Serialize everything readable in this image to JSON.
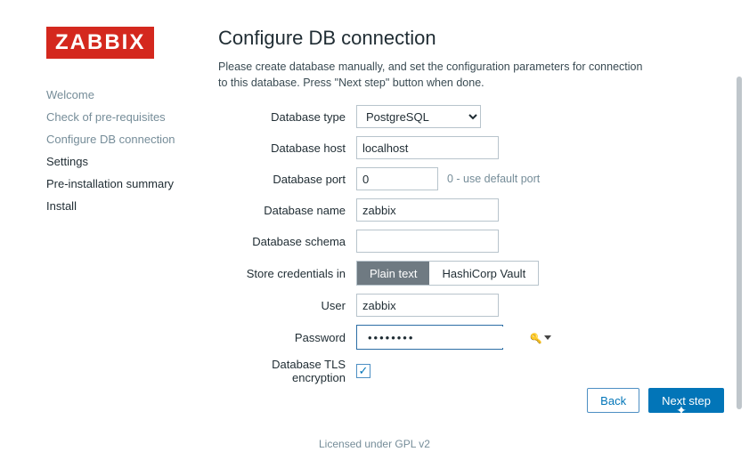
{
  "brand": "ZABBIX",
  "sidebar": {
    "items": [
      {
        "label": "Welcome"
      },
      {
        "label": "Check of pre-requisites"
      },
      {
        "label": "Configure DB connection"
      },
      {
        "label": "Settings"
      },
      {
        "label": "Pre-installation summary"
      },
      {
        "label": "Install"
      }
    ]
  },
  "page": {
    "title": "Configure DB connection",
    "description": "Please create database manually, and set the configuration parameters for connection to this database. Press \"Next step\" button when done."
  },
  "form": {
    "db_type": {
      "label": "Database type",
      "value": "PostgreSQL"
    },
    "db_host": {
      "label": "Database host",
      "value": "localhost"
    },
    "db_port": {
      "label": "Database port",
      "value": "0",
      "hint": "0 - use default port"
    },
    "db_name": {
      "label": "Database name",
      "value": "zabbix"
    },
    "db_schema": {
      "label": "Database schema",
      "value": ""
    },
    "store_creds": {
      "label": "Store credentials in",
      "options": [
        "Plain text",
        "HashiCorp Vault"
      ],
      "selected": "Plain text"
    },
    "user": {
      "label": "User",
      "value": "zabbix"
    },
    "password": {
      "label": "Password",
      "masked": "••••••••"
    },
    "tls": {
      "label": "Database TLS encryption",
      "checked": true,
      "checkmark": "✓"
    }
  },
  "buttons": {
    "back": "Back",
    "next": "Next step"
  },
  "footer": {
    "text": "Licensed under ",
    "link": "GPL v2"
  }
}
